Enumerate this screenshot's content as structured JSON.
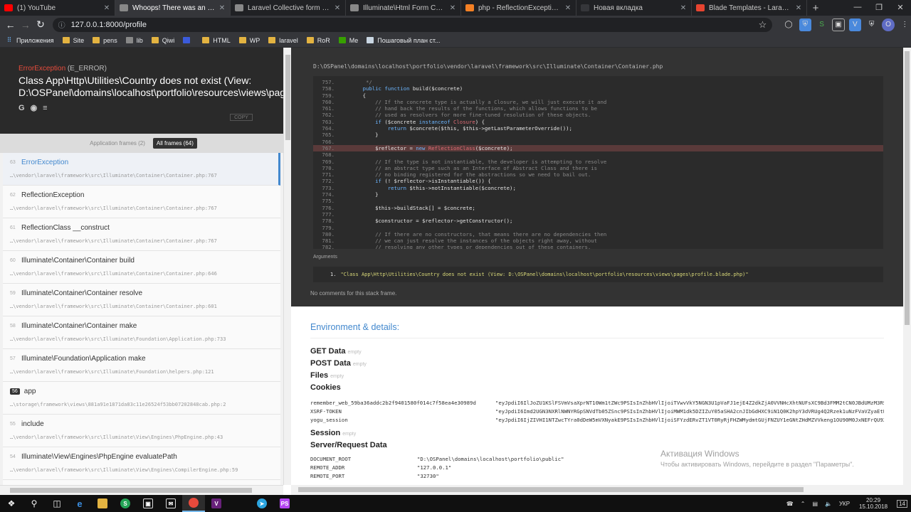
{
  "browser": {
    "tabs": [
      {
        "title": "(1) YouTube",
        "icon": "youtube-icon",
        "color": "#ff0000",
        "active": false
      },
      {
        "title": "Whoops! There was an error.",
        "icon": "page-icon",
        "color": "#888888",
        "active": true
      },
      {
        "title": "Laravel Collective form Country d...",
        "icon": "page-icon",
        "color": "#888888",
        "active": false
      },
      {
        "title": "Illuminate\\Html Form Country D...",
        "icon": "github-icon",
        "color": "#888888",
        "active": false
      },
      {
        "title": "php - ReflectionException: Class ...",
        "icon": "stackoverflow-icon",
        "color": "#f48024",
        "active": false
      },
      {
        "title": "Новая вкладка",
        "icon": "",
        "color": "#35363a",
        "active": false
      },
      {
        "title": "Blade Templates - Laravel - The P...",
        "icon": "laravel-icon",
        "color": "#e74430",
        "active": false
      }
    ],
    "url": "127.0.0.1:8000/profile",
    "bookmarks": [
      {
        "label": "Приложения",
        "icon": "apps-icon"
      },
      {
        "label": "Site",
        "icon": "folder-icon"
      },
      {
        "label": "pens",
        "icon": "folder-icon"
      },
      {
        "label": "lib",
        "icon": "lib-icon"
      },
      {
        "label": "Qiwi",
        "icon": "folder-icon"
      },
      {
        "label": "",
        "icon": "globe-icon"
      },
      {
        "label": "HTML",
        "icon": "folder-icon"
      },
      {
        "label": "WP",
        "icon": "folder-icon"
      },
      {
        "label": "laravel",
        "icon": "folder-icon"
      },
      {
        "label": "RoR",
        "icon": "folder-icon"
      },
      {
        "label": "Me",
        "icon": "upwork-icon"
      },
      {
        "label": "Пошаговый план ст...",
        "icon": "hh-icon"
      }
    ]
  },
  "error": {
    "type": "ErrorException",
    "code": "(E_ERROR)",
    "message": "Class App\\Http\\Utilities\\Country does not exist (View: D:\\OSPanel\\domains\\localhost\\portfolio\\resources\\views\\pages\\profile.blade.php)",
    "copy_label": "COPY"
  },
  "filters": {
    "app_frames": "Application frames (2)",
    "all_frames": "All frames (64)"
  },
  "frames": [
    {
      "index": "63",
      "class": "ErrorException",
      "file": "…\\vendor\\laravel\\framework\\src\\Illuminate\\Container\\Container.php:767",
      "active": true,
      "app": false
    },
    {
      "index": "62",
      "class": "ReflectionException",
      "file": "…\\vendor\\laravel\\framework\\src\\Illuminate\\Container\\Container.php:767",
      "active": false,
      "app": false
    },
    {
      "index": "61",
      "class": "ReflectionClass __construct",
      "file": "…\\vendor\\laravel\\framework\\src\\Illuminate\\Container\\Container.php:767",
      "active": false,
      "app": false
    },
    {
      "index": "60",
      "class": "Illuminate\\Container\\Container build",
      "file": "…\\vendor\\laravel\\framework\\src\\Illuminate\\Container\\Container.php:646",
      "active": false,
      "app": false
    },
    {
      "index": "59",
      "class": "Illuminate\\Container\\Container resolve",
      "file": "…\\vendor\\laravel\\framework\\src\\Illuminate\\Container\\Container.php:601",
      "active": false,
      "app": false
    },
    {
      "index": "58",
      "class": "Illuminate\\Container\\Container make",
      "file": "…\\vendor\\laravel\\framework\\src\\Illuminate\\Foundation\\Application.php:733",
      "active": false,
      "app": false
    },
    {
      "index": "57",
      "class": "Illuminate\\Foundation\\Application make",
      "file": "…\\vendor\\laravel\\framework\\src\\Illuminate\\Foundation\\helpers.php:121",
      "active": false,
      "app": false
    },
    {
      "index": "56",
      "class": "app",
      "file": "…\\storage\\framework\\views\\881a91e1871da83c11e26524f53bb07202848cab.php:2",
      "active": false,
      "app": true
    },
    {
      "index": "55",
      "class": "include",
      "file": "…\\vendor\\laravel\\framework\\src\\Illuminate\\View\\Engines\\PhpEngine.php:43",
      "active": false,
      "app": false
    },
    {
      "index": "54",
      "class": "Illuminate\\View\\Engines\\PhpEngine evaluatePath",
      "file": "…\\vendor\\laravel\\framework\\src\\Illuminate\\View\\Engines\\CompilerEngine.php:59",
      "active": false,
      "app": false
    }
  ],
  "code": {
    "file": "D:\\OSPanel\\domains\\localhost\\portfolio\\vendor\\laravel\\framework\\src\\Illuminate\\Container\\Container.php",
    "highlight_line": "767",
    "lines": [
      {
        "n": "757.",
        "t": "     */",
        "k": "cm"
      },
      {
        "n": "758.",
        "t": "    public function build($concrete)",
        "k": "def"
      },
      {
        "n": "759.",
        "t": "    {",
        "k": "plain"
      },
      {
        "n": "760.",
        "t": "        // If the concrete type is actually a Closure, we will just execute it and",
        "k": "cm"
      },
      {
        "n": "761.",
        "t": "        // hand back the results of the functions, which allows functions to be",
        "k": "cm"
      },
      {
        "n": "762.",
        "t": "        // used as resolvers for more fine-tuned resolution of these objects.",
        "k": "cm"
      },
      {
        "n": "763.",
        "t": "        if ($concrete instanceof Closure) {",
        "k": "plain"
      },
      {
        "n": "764.",
        "t": "            return $concrete($this, $this->getLastParameterOverride());",
        "k": "plain"
      },
      {
        "n": "765.",
        "t": "        }",
        "k": "plain"
      },
      {
        "n": "766.",
        "t": "",
        "k": "plain"
      },
      {
        "n": "767.",
        "t": "        $reflector = new ReflectionClass($concrete);",
        "k": "plain"
      },
      {
        "n": "768.",
        "t": "",
        "k": "plain"
      },
      {
        "n": "769.",
        "t": "        // If the type is not instantiable, the developer is attempting to resolve",
        "k": "cm"
      },
      {
        "n": "770.",
        "t": "        // an abstract type such as an Interface of Abstract Class and there is",
        "k": "cm"
      },
      {
        "n": "771.",
        "t": "        // no binding registered for the abstractions so we need to bail out.",
        "k": "cm"
      },
      {
        "n": "772.",
        "t": "        if (! $reflector->isInstantiable()) {",
        "k": "plain"
      },
      {
        "n": "773.",
        "t": "            return $this->notInstantiable($concrete);",
        "k": "plain"
      },
      {
        "n": "774.",
        "t": "        }",
        "k": "plain"
      },
      {
        "n": "775.",
        "t": "",
        "k": "plain"
      },
      {
        "n": "776.",
        "t": "        $this->buildStack[] = $concrete;",
        "k": "plain"
      },
      {
        "n": "777.",
        "t": "",
        "k": "plain"
      },
      {
        "n": "778.",
        "t": "        $constructor = $reflector->getConstructor();",
        "k": "plain"
      },
      {
        "n": "779.",
        "t": "",
        "k": "plain"
      },
      {
        "n": "780.",
        "t": "        // If there are no constructors, that means there are no dependencies then",
        "k": "cm"
      },
      {
        "n": "781.",
        "t": "        // we can just resolve the instances of the objects right away, without",
        "k": "cm"
      },
      {
        "n": "782.",
        "t": "        // resolving any other types or dependencies out of these containers.",
        "k": "cm"
      }
    ],
    "arguments_label": "Arguments",
    "argument": "\"Class App\\Http\\Utilities\\Country does not exist (View: D:\\OSPanel\\domains\\localhost\\portfolio\\resources\\views\\pages\\profile.blade.php)\"",
    "argument_index": "1.",
    "no_comments": "No comments for this stack frame."
  },
  "env": {
    "title": "Environment & details:",
    "get_data": "GET Data",
    "post_data": "POST Data",
    "files": "Files",
    "cookies": "Cookies",
    "session": "Session",
    "server": "Server/Request Data",
    "empty": "empty",
    "cookie_rows": [
      {
        "k": "remember_web_59ba36addc2b2f9401580f014c7f58ea4e30989d",
        "v": "\"eyJpdiI6IlJoZU1KSlFSVmVsaXprNT10Wm1tZWc9PSIsInZhbHVlIjoiTVwvVkY5NGN3U1pVaFJ1ejE4Z2dkZjA0VVNHcXhtNUFsXC9Bd3FMM2tCN0JBdUMzM3RSRGh1M"
      },
      {
        "k": "XSRF-TOKEN",
        "v": "\"eyJpdiI6Imd2UGN3NXRlNWNYRGpSNVdTb05ZSnc9PSIsInZhbHVlIjoiMWM1dk5DZIZuY05aSHA2cnJIbGdHXC9iN1Q0K2hpY3dVRUg4Q2Rzek1uNzFVaVZyaEtWa1MrV"
      },
      {
        "k": "yogu_session",
        "v": "\"eyJpdiI6IjZIVHI1NTZwcTYra0dDeW5mVXNyakE9PSIsInZhbHVlIjoiSFYzdERvZT1VT0RyRjFHZWMydmtGUjFNZUY1eGNtZHdMZVVkeng1OU90M0JxNEFrQU92Qmxtc"
      }
    ],
    "server_rows": [
      {
        "k": "DOCUMENT_ROOT",
        "v": "\"D:\\OSPanel\\domains\\localhost\\portfolio\\public\""
      },
      {
        "k": "REMOTE_ADDR",
        "v": "\"127.0.0.1\""
      },
      {
        "k": "REMOTE_PORT",
        "v": "\"32730\""
      }
    ]
  },
  "activation": {
    "title": "Активация Windows",
    "subtitle": "Чтобы активировать Windows, перейдите в раздел \"Параметры\"."
  },
  "taskbar": {
    "lang": "УКР",
    "time": "20:29",
    "date": "15.10.2018",
    "notifications": "14"
  }
}
